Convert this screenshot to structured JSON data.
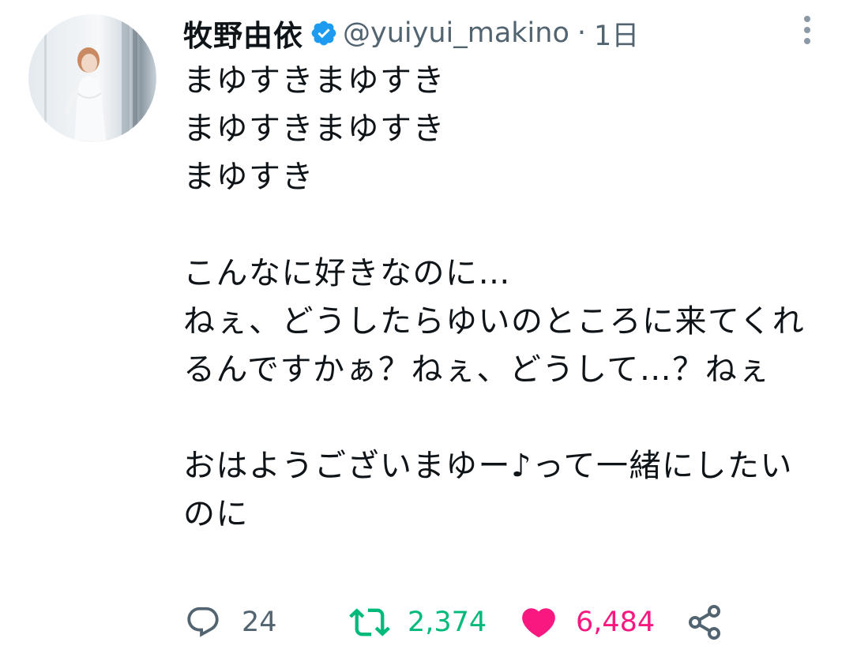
{
  "tweet": {
    "display_name": "牧野由依",
    "handle": "@yuiyui_makino",
    "separator": "·",
    "timestamp": "1日",
    "text": "まゆすきまゆすき\nまゆすきまゆすき\nまゆすき\n\nこんなに好きなのに…\nねぇ、どうしたらゆいのところに来てくれるんですかぁ？ねぇ、どうして…？ねぇ\n\nおはようございまゆー♪って一緒にしたいのに",
    "stats": {
      "replies": "24",
      "retweets": "2,374",
      "likes": "6,484"
    }
  },
  "colors": {
    "verified": "#1d9bf0",
    "retweet": "#00ba7c",
    "like": "#f91880",
    "secondary_text": "#536471"
  },
  "icons": {
    "verified": "verified-badge-icon",
    "more": "more-vertical-icon",
    "reply": "reply-bubble-icon",
    "retweet": "retweet-arrows-icon",
    "like": "heart-filled-icon",
    "share": "share-nodes-icon"
  }
}
